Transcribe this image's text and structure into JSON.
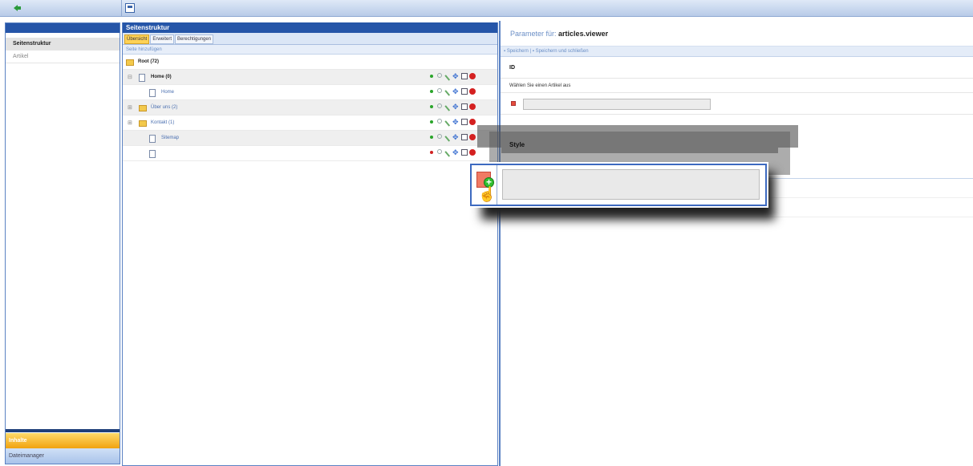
{
  "sidebar": {
    "items": [
      {
        "label": "Seitenstruktur",
        "active": true
      },
      {
        "label": "Artikel",
        "active": false
      }
    ],
    "accordion": [
      {
        "label": "Inhalte",
        "active": true
      },
      {
        "label": "Dateimanager",
        "active": false
      }
    ]
  },
  "middle": {
    "title": "Seitenstruktur",
    "tabs": [
      "Übersicht",
      "Erweitert",
      "Berechtigungen"
    ],
    "add_page": "Seite hinzufügen",
    "tree": [
      {
        "label": "Root (72)",
        "type": "folder",
        "indent": 0,
        "bold": true
      },
      {
        "label": "Home (0)",
        "type": "page",
        "indent": 1,
        "bold": true,
        "expander": "–",
        "actions": true
      },
      {
        "label": "Home",
        "type": "page",
        "indent": 2,
        "bold": false,
        "actions": true
      },
      {
        "label": "Über uns (2)",
        "type": "folder",
        "indent": 1,
        "bold": false,
        "expander": "+",
        "actions": true
      },
      {
        "label": "Kontakt (1)",
        "type": "folder",
        "indent": 1,
        "bold": false,
        "expander": "+",
        "actions": true
      },
      {
        "label": "Sitemap",
        "type": "page",
        "indent": 2,
        "bold": false,
        "actions": true
      },
      {
        "label": "",
        "type": "page",
        "indent": 2,
        "bold": false,
        "actions": true,
        "status": "red"
      }
    ]
  },
  "right": {
    "title_prefix": "Parameter für:",
    "title_value": "articles.viewer",
    "toolbar": {
      "save": "Speichern",
      "save_close": "Speichern und schließen"
    },
    "id_label": "ID",
    "prompt": "Wählen Sie einen Artikel aus",
    "style_label": "Style"
  },
  "colors": {
    "header_blue": "#2555a8",
    "accent_orange": "#f1a30f",
    "border_blue": "#5b82c3"
  },
  "icons": {
    "back": "back-arrow-icon",
    "window": "window-icon",
    "add": "add-plus-icon",
    "cursor": "hand-cursor-icon"
  }
}
